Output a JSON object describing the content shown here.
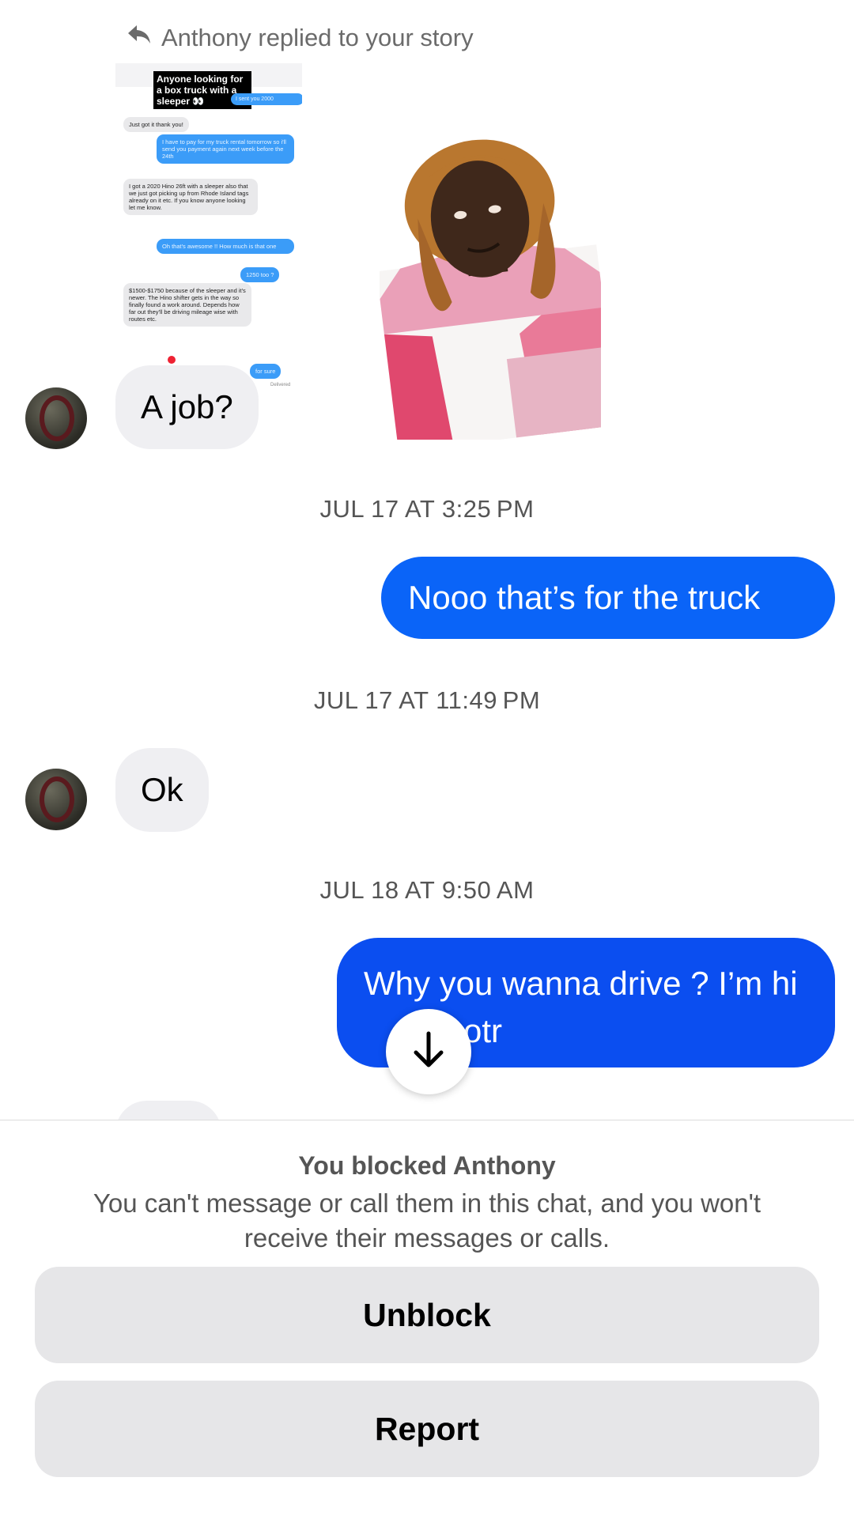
{
  "reply_header": {
    "text": "Anthony replied to your story",
    "icon": "reply-arrow-icon"
  },
  "story_preview": {
    "caption": "Anyone looking for a box truck with a sleeper 👀",
    "messages": [
      {
        "direction": "out",
        "text": "I sent you 2000"
      },
      {
        "direction": "in",
        "text": "Just got it thank you!"
      },
      {
        "direction": "out",
        "text": "I have to pay for my truck rental tomorrow so i'll send you payment again next week before the 24th"
      },
      {
        "direction": "in",
        "text": "I got a 2020 Hino 26ft with a sleeper also that we just got picking up from Rhode Island tags already on it etc. If you know anyone looking let me know."
      },
      {
        "direction": "out",
        "text": "Oh that's awesome !! How much is that one"
      },
      {
        "direction": "out",
        "text": "1250 too ?"
      },
      {
        "direction": "in",
        "text": "$1500-$1750 because of the sleeper and it's newer. The Hino shifter gets in the way so finally found a work around. Depends how far out they'll be driving mileage wise with routes etc."
      },
      {
        "direction": "out",
        "text": "for sure"
      },
      {
        "direction": "status",
        "text": "Delivered"
      }
    ]
  },
  "messages": [
    {
      "type": "incoming",
      "text": "A job?"
    },
    {
      "type": "timestamp",
      "text": "JUL 17 AT 3:25 PM"
    },
    {
      "type": "outgoing",
      "text": "Nooo that’s for the truck"
    },
    {
      "type": "timestamp",
      "text": "JUL 17 AT 11:49 PM"
    },
    {
      "type": "incoming",
      "text": "Ok"
    },
    {
      "type": "timestamp",
      "text": "JUL 18 AT 9:50 AM"
    },
    {
      "type": "outgoing",
      "text": "Why you wanna drive ? I’m hi",
      "text_after": "otr"
    }
  ],
  "scroll_button": {
    "icon": "arrow-down-icon"
  },
  "blocked": {
    "title": "You blocked Anthony",
    "description": "You can't message or call them in this chat, and you won't receive their messages or calls.",
    "unblock_label": "Unblock",
    "report_label": "Report"
  },
  "colors": {
    "outgoing_bubble": "#0a64f8",
    "incoming_bubble": "#efeff2",
    "button_bg": "#e6e6e8"
  }
}
